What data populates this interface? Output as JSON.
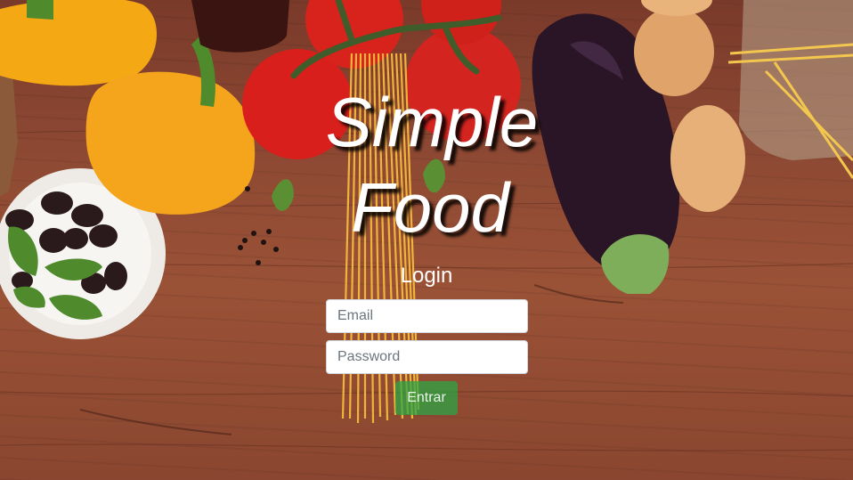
{
  "title": {
    "line1": "Simple",
    "line2": "Food"
  },
  "login": {
    "heading": "Login",
    "email_placeholder": "Email",
    "password_placeholder": "Password",
    "submit_label": "Entrar"
  },
  "colors": {
    "submit": "#28a745",
    "title": "#ffffff"
  },
  "background": {
    "image": "vegetables-on-wooden-table"
  }
}
